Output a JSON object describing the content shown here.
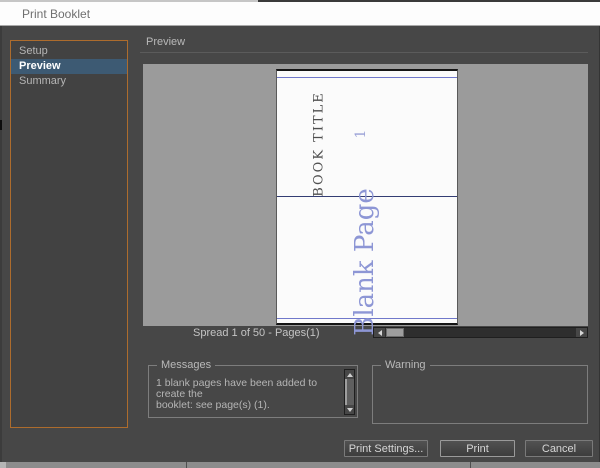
{
  "window": {
    "title": "Print Booklet"
  },
  "sidebar": {
    "items": [
      {
        "label": "Setup",
        "selected": false
      },
      {
        "label": "Preview",
        "selected": true
      },
      {
        "label": "Summary",
        "selected": false
      }
    ]
  },
  "main": {
    "section_title": "Preview",
    "spread": {
      "book_title": "BOOK TITLE",
      "page_number": "1",
      "blank_page_label": "Blank Page"
    },
    "spread_status": "Spread 1 of 50 - Pages(1)"
  },
  "messages": {
    "label": "Messages",
    "line1": "1 blank pages have been added to create the",
    "line2": "booklet: see page(s) (1)."
  },
  "warning": {
    "label": "Warning"
  },
  "buttons": {
    "print_settings": "Print Settings...",
    "print": "Print",
    "cancel": "Cancel"
  },
  "icons": {
    "scroll_left": "left-triangle",
    "scroll_right": "right-triangle",
    "scroll_up": "up-triangle",
    "scroll_down": "down-triangle"
  },
  "colors": {
    "dialog_bg": "#474747",
    "titlebar_bg": "#fdfdfd",
    "sidebar_focus_border": "#ad6c2d",
    "selected_item_bg": "#3d5a73",
    "preview_canvas_bg": "#9b9b9b",
    "page_margin_line": "#7078ca",
    "spine_line": "#333d73",
    "blank_page_text": "#8d96d5"
  }
}
